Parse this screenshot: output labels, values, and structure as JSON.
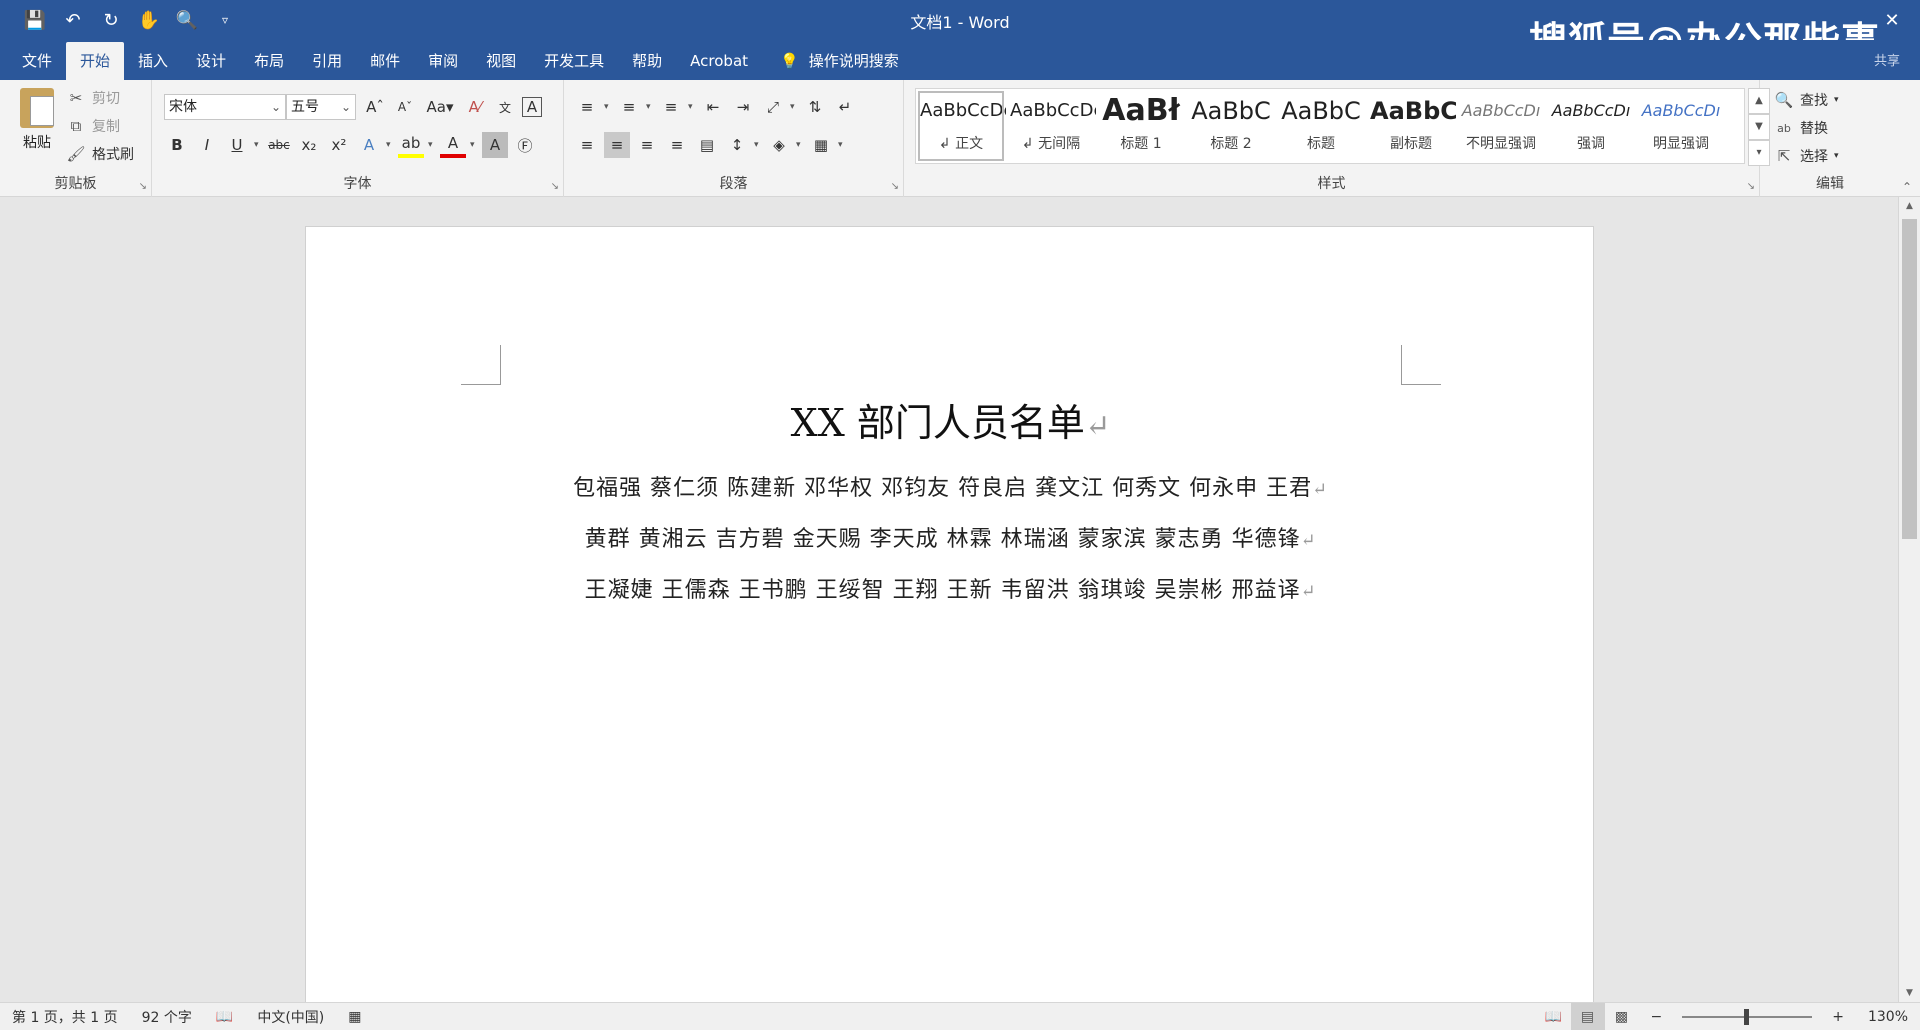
{
  "title_bar": {
    "document_title": "文档1 - Word",
    "watermark": "搜狐号@办公那些事",
    "qat_icons": [
      "save-icon",
      "undo-icon",
      "redo-icon",
      "touch-mode-icon",
      "print-preview-icon",
      "customize-qat-icon"
    ]
  },
  "tabs": {
    "items": [
      "文件",
      "开始",
      "插入",
      "设计",
      "布局",
      "引用",
      "邮件",
      "审阅",
      "视图",
      "开发工具",
      "帮助",
      "Acrobat"
    ],
    "active": "开始",
    "tell_me": "操作说明搜索",
    "share": "共享"
  },
  "clipboard": {
    "paste": "粘贴",
    "cut": "剪切",
    "copy": "复制",
    "format_painter": "格式刷",
    "label": "剪贴板"
  },
  "font": {
    "name": "宋体",
    "size": "五号",
    "change_case": "Aa",
    "label": "字体"
  },
  "paragraph": {
    "label": "段落"
  },
  "styles": {
    "items": [
      {
        "preview": "AaBbCcDc",
        "name": "↲ 正文"
      },
      {
        "preview": "AaBbCcDc",
        "name": "↲ 无间隔"
      },
      {
        "preview": "AaBł",
        "name": "标题 1"
      },
      {
        "preview": "AaBbC",
        "name": "标题 2"
      },
      {
        "preview": "AaBbC",
        "name": "标题"
      },
      {
        "preview": "AaBbC",
        "name": "副标题"
      },
      {
        "preview": "AaBbCcDı",
        "name": "不明显强调"
      },
      {
        "preview": "AaBbCcDı",
        "name": "强调"
      },
      {
        "preview": "AaBbCcDı",
        "name": "明显强调"
      }
    ],
    "label": "样式"
  },
  "editing": {
    "find": "查找",
    "replace": "替换",
    "select": "选择",
    "label": "编辑"
  },
  "document": {
    "heading": "XX 部门人员名单",
    "lines": [
      "包福强  蔡仁须  陈建新  邓华权  邓钧友  符良启  龚文江  何秀文  何永申  王君",
      "黄群  黄湘云  吉方碧  金天赐  李天成  林霖  林瑞涵  蒙家滨  蒙志勇  华德锋",
      "王凝婕  王儒森  王书鹏  王绥智  王翔  王新  韦留洪  翁琪竣  吴崇彬  邢益译"
    ],
    "paragraph_mark": "↵"
  },
  "status": {
    "page": "第 1 页，共 1 页",
    "words": "92 个字",
    "language": "中文(中国)",
    "zoom": "130%",
    "zoom_minus": "−",
    "zoom_plus": "+"
  }
}
